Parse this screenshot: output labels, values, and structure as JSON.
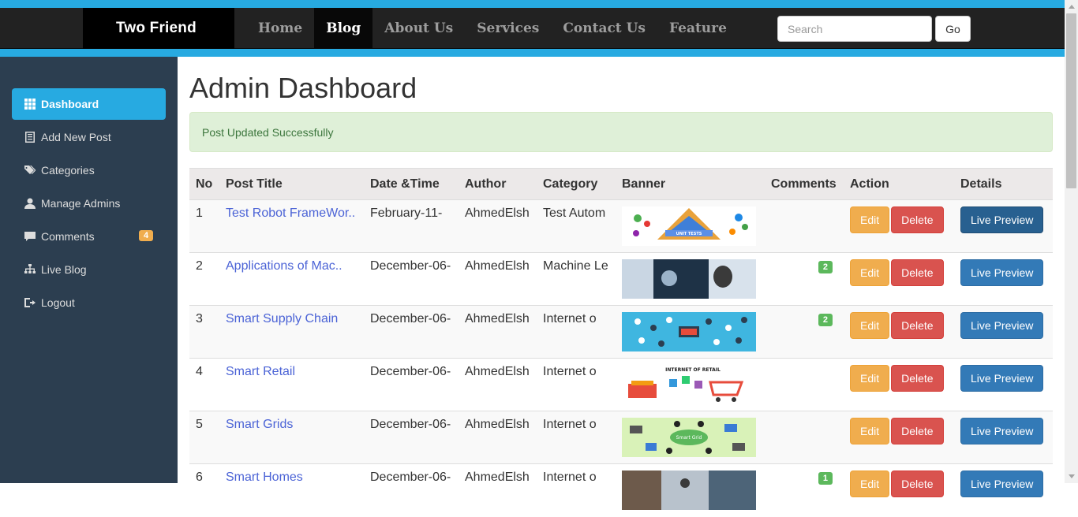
{
  "brand": "Two Friend",
  "nav": [
    "Home",
    "Blog",
    "About Us",
    "Services",
    "Contact Us",
    "Feature"
  ],
  "search": {
    "placeholder": "Search",
    "button": "Go"
  },
  "sidebar": {
    "items": [
      {
        "label": "Dashboard",
        "icon": "grid-icon"
      },
      {
        "label": "Add New Post",
        "icon": "list-alt-icon"
      },
      {
        "label": "Categories",
        "icon": "tags-icon"
      },
      {
        "label": "Manage Admins",
        "icon": "user-icon"
      },
      {
        "label": "Comments",
        "icon": "comment-icon",
        "badge": "4"
      },
      {
        "label": "Live Blog",
        "icon": "tree-icon"
      },
      {
        "label": "Logout",
        "icon": "logout-icon"
      }
    ]
  },
  "page": {
    "title": "Admin Dashboard",
    "alert": "Post Updated Successfully"
  },
  "table": {
    "headers": [
      "No",
      "Post Title",
      "Date &Time",
      "Author",
      "Category",
      "Banner",
      "Comments",
      "Action",
      "Details"
    ],
    "rows": [
      {
        "no": "1",
        "title": "Test Robot FrameWor..",
        "date": "February-11-",
        "author": "AhmedElsh",
        "category": "Test Autom",
        "banner": "unit-tests-pyramid",
        "comments": ""
      },
      {
        "no": "2",
        "title": "Applications of Mac..",
        "date": "December-06-",
        "author": "AhmedElsh",
        "category": "Machine Le",
        "banner": "machine-learning-photo",
        "comments": "2"
      },
      {
        "no": "3",
        "title": "Smart Supply Chain",
        "date": "December-06-",
        "author": "AhmedElsh",
        "category": "Internet o",
        "banner": "supply-chain-icons",
        "comments": "2"
      },
      {
        "no": "4",
        "title": "Smart Retail",
        "date": "December-06-",
        "author": "AhmedElsh",
        "category": "Internet o",
        "banner": "internet-of-retail",
        "comments": ""
      },
      {
        "no": "5",
        "title": "Smart Grids",
        "date": "December-06-",
        "author": "AhmedElsh",
        "category": "Internet o",
        "banner": "smart-grid",
        "comments": ""
      },
      {
        "no": "6",
        "title": "Smart Homes",
        "date": "December-06-",
        "author": "AhmedElsh",
        "category": "Internet o",
        "banner": "smart-homes-photo",
        "comments": "1"
      }
    ],
    "actions": {
      "edit": "Edit",
      "delete": "Delete",
      "preview": "Live Preview"
    }
  },
  "banner_texts": {
    "unit_tests": "UNIT TESTS",
    "retail": "INTERNET OF RETAIL",
    "grid": "Smart Grid"
  },
  "colors": {
    "accent": "#27aae1",
    "sidebar": "#2c3e50",
    "navbar": "#222222",
    "success": "#5cb85c",
    "warning": "#f0ad4e",
    "danger": "#d9534f",
    "primary": "#337ab7"
  }
}
